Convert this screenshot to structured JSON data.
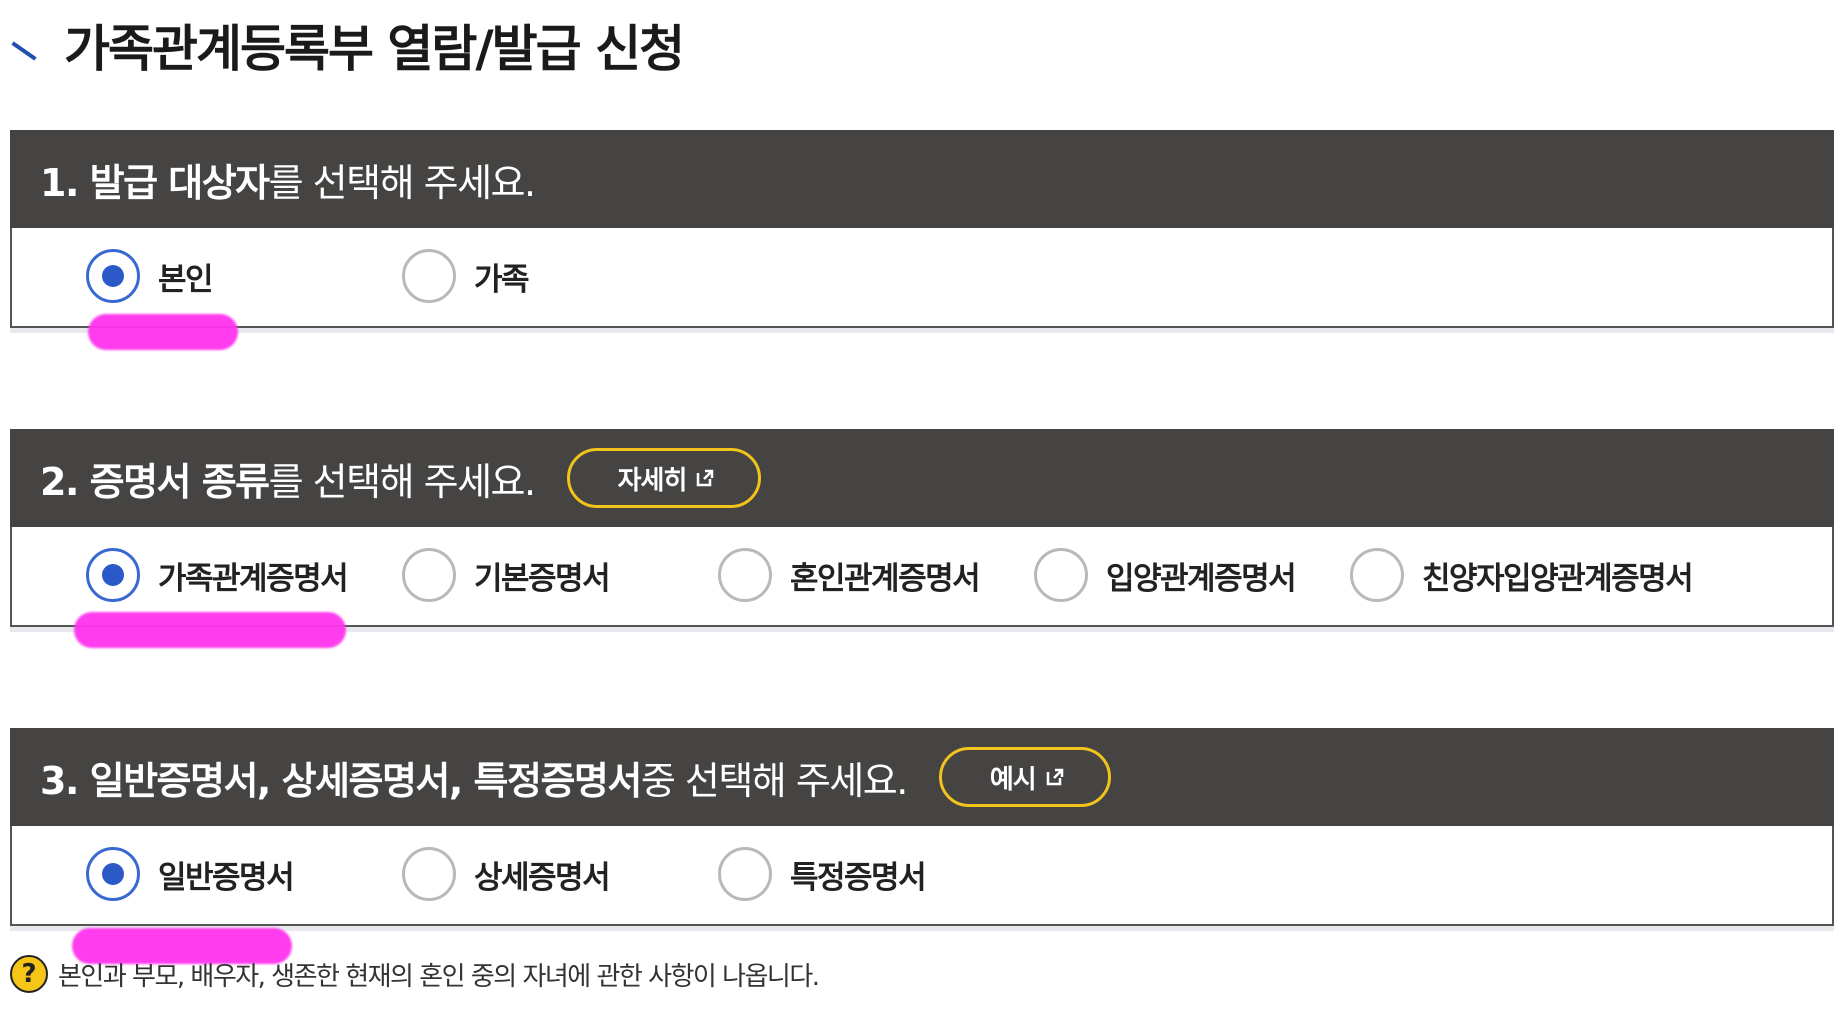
{
  "page": {
    "title": "가족관계등록부 열람/발급 신청"
  },
  "section1": {
    "header_bold": "1. 발급 대상자",
    "header_normal": "를 선택해 주세요.",
    "options": [
      {
        "label": "본인",
        "checked": true
      },
      {
        "label": "가족",
        "checked": false
      }
    ]
  },
  "section2": {
    "header_bold": "2. 증명서 종류",
    "header_normal": "를 선택해 주세요.",
    "button_label": "자세히",
    "options": [
      {
        "label": "가족관계증명서",
        "checked": true
      },
      {
        "label": "기본증명서",
        "checked": false
      },
      {
        "label": "혼인관계증명서",
        "checked": false
      },
      {
        "label": "입양관계증명서",
        "checked": false
      },
      {
        "label": "친양자입양관계증명서",
        "checked": false
      }
    ]
  },
  "section3": {
    "header_bold": "3. 일반증명서, 상세증명서, 특정증명서",
    "header_normal": " 중 선택해 주세요.",
    "button_label": "예시",
    "options": [
      {
        "label": "일반증명서",
        "checked": true
      },
      {
        "label": "상세증명서",
        "checked": false
      },
      {
        "label": "특정증명서",
        "checked": false
      }
    ]
  },
  "help": {
    "icon": "?",
    "text": "본인과 부모, 배우자, 생존한 현재의 혼인 중의 자녀에 관한 사항이 나옵니다."
  },
  "colors": {
    "header_bg": "#454443",
    "accent_blue": "#2b59c8",
    "button_border": "#f2c31b",
    "highlight": "#ff33ee"
  }
}
